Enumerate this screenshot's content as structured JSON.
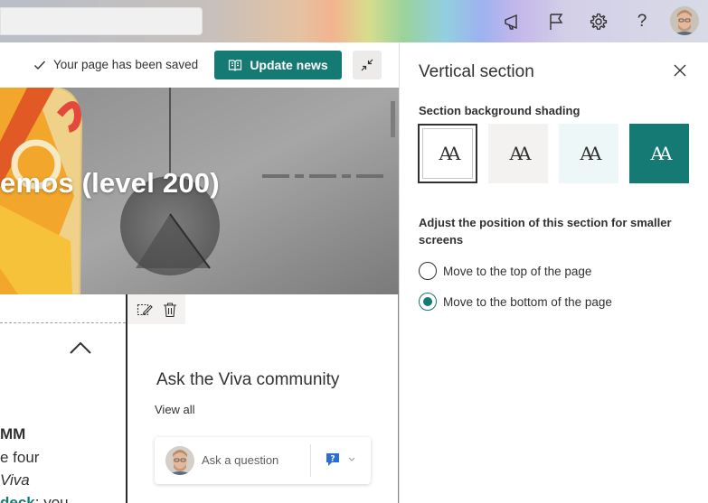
{
  "suite": {
    "icons": [
      "megaphone-icon",
      "flag-icon",
      "gear-icon",
      "help-icon"
    ],
    "help_glyph": "?"
  },
  "command_bar": {
    "saved_text": "Your page has been saved",
    "update_label": "Update news"
  },
  "hero": {
    "title": "emos (level 200)"
  },
  "left_column": {
    "line1": "MM",
    "line2": "e four",
    "line3": "Viva",
    "line4_bold": "deck",
    "line4_rest": ": you"
  },
  "community": {
    "title": "Ask the Viva community",
    "view_all": "View all",
    "ask_placeholder": "Ask a question"
  },
  "pane": {
    "title": "Vertical section",
    "shading_label": "Section background shading",
    "shading_glyph": "AA",
    "shading_options": [
      {
        "name": "none",
        "bg": "#ffffff",
        "selected": true
      },
      {
        "name": "neutral",
        "bg": "#f3f2f1",
        "selected": false
      },
      {
        "name": "soft",
        "bg": "#eef7f7",
        "selected": false
      },
      {
        "name": "strong",
        "bg": "#157a74",
        "selected": false
      }
    ],
    "adjust_label": "Adjust the position of this section for smaller screens",
    "options": [
      {
        "label": "Move to the top of the page",
        "checked": false
      },
      {
        "label": "Move to the bottom of the page",
        "checked": true
      }
    ]
  },
  "colors": {
    "accent": "#157a74"
  }
}
